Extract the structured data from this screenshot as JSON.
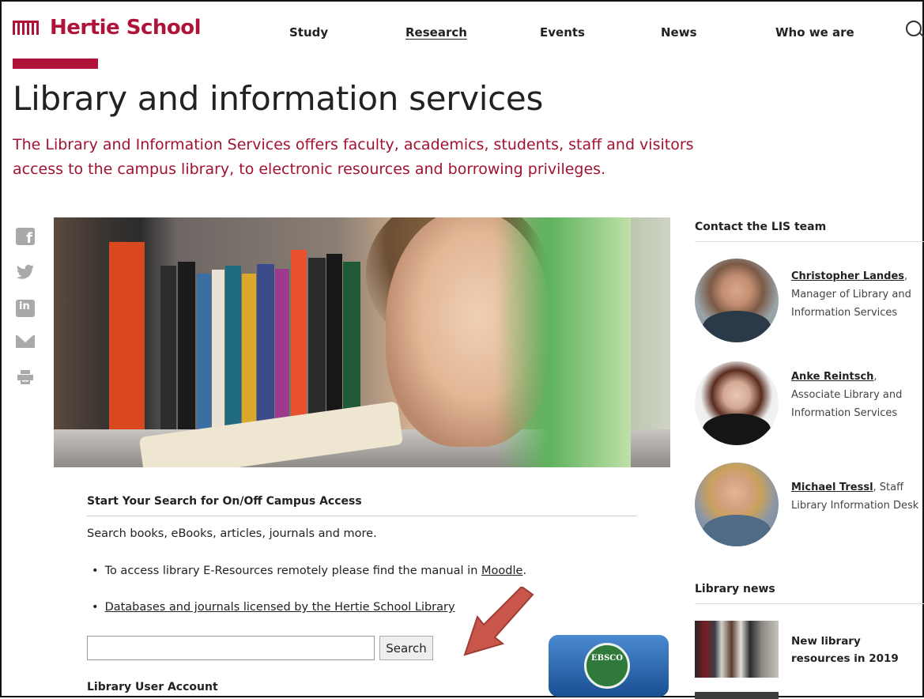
{
  "header": {
    "logo_text": "Hertie School",
    "nav": [
      "Study",
      "Research",
      "Events",
      "News",
      "Who we are"
    ],
    "active_nav": "Research",
    "accent_color": "#b0133a"
  },
  "page": {
    "title": "Library and information services",
    "intro": "The Library and Information Services offers faculty, academics, students, staff and visitors access to the campus library, to electronic resources and borrowing privileges."
  },
  "share_icons": [
    "facebook-icon",
    "twitter-icon",
    "linkedin-icon",
    "mail-icon",
    "print-icon"
  ],
  "search_panel": {
    "heading": "Start Your Search for On/Off Campus Access",
    "description": "Search books, eBooks, articles, journals and more.",
    "bullet1_text": "To access library E-Resources remotely please find the manual in ",
    "bullet1_link": "Moodle",
    "bullet1_end": ".",
    "bullet2_link": "Databases and journals licensed by the Hertie School Library",
    "search_placeholder": "",
    "search_button": "Search",
    "account_heading": "Library User Account",
    "ebsco_label": "EBSCO"
  },
  "sidebar": {
    "contact_heading": "Contact the LIS team",
    "people": [
      {
        "name": "Christopher Landes",
        "role": ", Manager of Library and Information Services"
      },
      {
        "name": "Anke Reintsch",
        "role": ", Associate Library and Information Services"
      },
      {
        "name": "Michael Tressl",
        "role": ", Staff Library Information Desk"
      }
    ],
    "news_heading": "Library news",
    "news_items": [
      {
        "title": "New library resources in 2019"
      }
    ]
  }
}
